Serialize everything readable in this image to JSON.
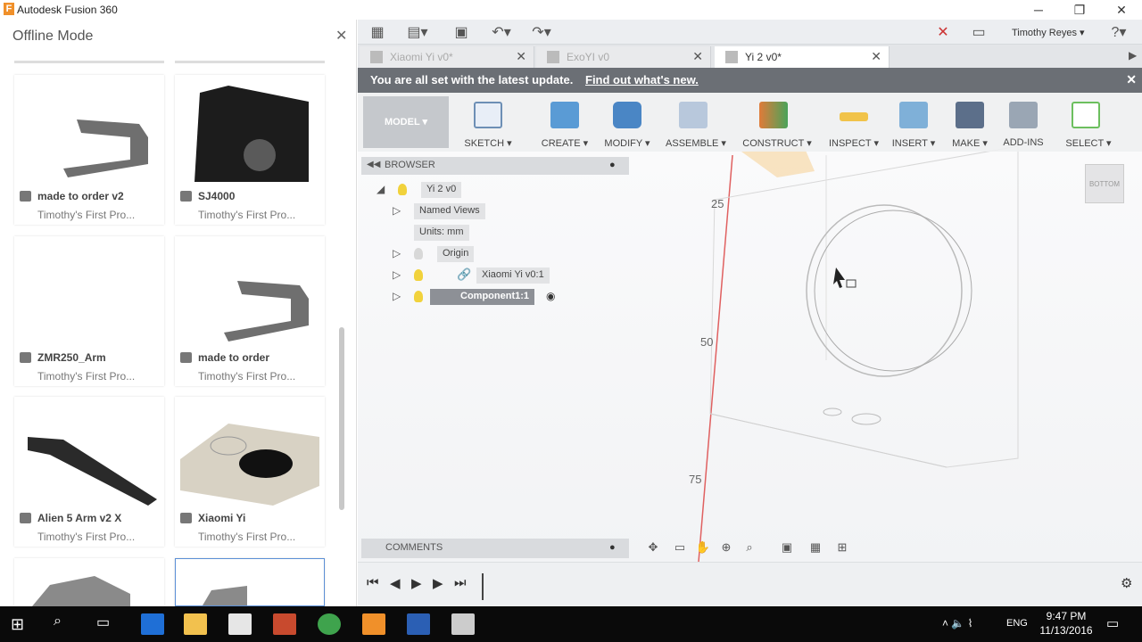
{
  "app": {
    "title": "Autodesk Fusion 360"
  },
  "left_panel": {
    "title": "Offline Mode",
    "cards": [
      {
        "name": "made to order v2",
        "project": "Timothy's First Pro..."
      },
      {
        "name": "SJ4000",
        "project": "Timothy's First Pro..."
      },
      {
        "name": "ZMR250_Arm",
        "project": "Timothy's First Pro..."
      },
      {
        "name": "made to order",
        "project": "Timothy's First Pro..."
      },
      {
        "name": "Alien 5 Arm v2 X",
        "project": "Timothy's First Pro..."
      },
      {
        "name": "Xiaomi Yi",
        "project": "Timothy's First Pro..."
      }
    ]
  },
  "top_bar": {
    "user": "Timothy Reyes"
  },
  "doc_tabs": [
    {
      "label": "Xiaomi Yi v0*"
    },
    {
      "label": "ExoYI v0"
    },
    {
      "label": "Yi 2 v0*"
    }
  ],
  "banner": {
    "text": "You are all set with the latest update.",
    "link": "Find out what's new."
  },
  "toolbar": {
    "workspace": "MODEL ▾",
    "tools": [
      "SKETCH ▾",
      "CREATE ▾",
      "MODIFY ▾",
      "ASSEMBLE ▾",
      "CONSTRUCT ▾",
      "INSPECT ▾",
      "INSERT ▾",
      "MAKE ▾",
      "ADD-INS",
      "SELECT ▾"
    ]
  },
  "browser": {
    "header": "BROWSER",
    "nodes": [
      {
        "label": "Yi 2 v0"
      },
      {
        "label": "Named Views"
      },
      {
        "label": "Units: mm"
      },
      {
        "label": "Origin"
      },
      {
        "label": "Xiaomi Yi v0:1"
      },
      {
        "label": "Component1:1"
      }
    ]
  },
  "viewport": {
    "axis_labels": [
      "25",
      "50",
      "75"
    ],
    "corner_label": "BOTTOM"
  },
  "comments": {
    "header": "COMMENTS"
  },
  "taskbar": {
    "lang": "ENG",
    "time": "9:47 PM",
    "date": "11/13/2016"
  },
  "colors": {
    "banner": "#6b6f75",
    "selected": "#8d9096",
    "taskbar": "#0a0a0a",
    "accent": "#f0902a"
  }
}
